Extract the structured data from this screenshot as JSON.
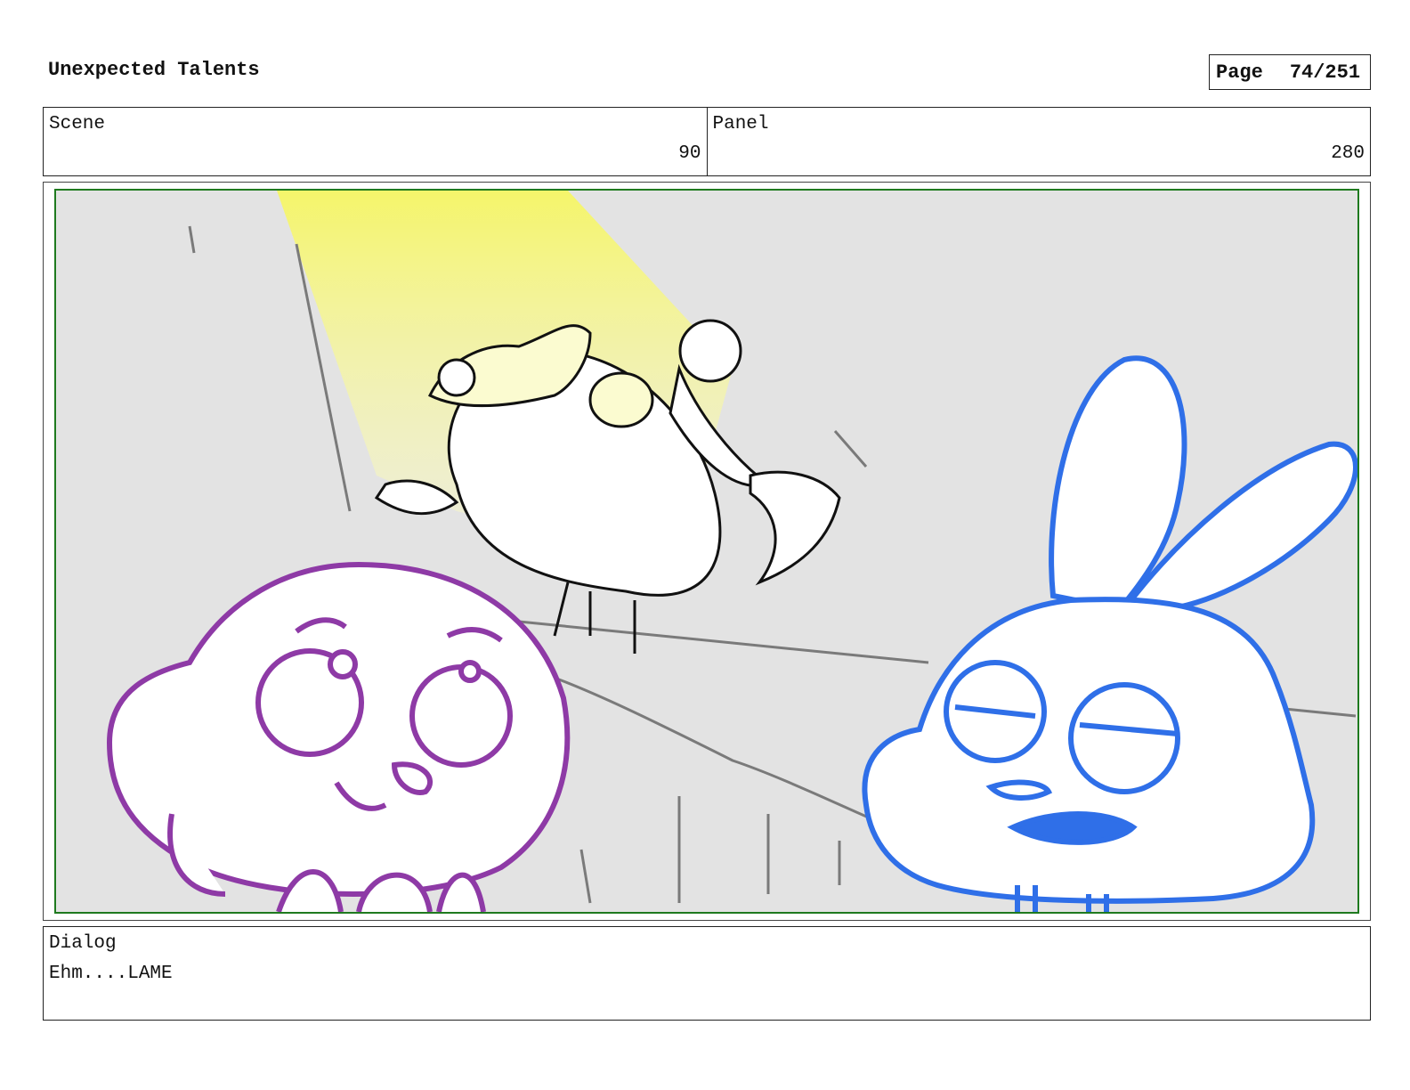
{
  "header": {
    "title": "Unexpected Talents",
    "page_label": "Page",
    "page_number": "74/251"
  },
  "scene": {
    "label": "Scene",
    "value": "90"
  },
  "panel": {
    "label": "Panel",
    "value": "280"
  },
  "artwork": {
    "colors": {
      "background": "#e3e3e3",
      "spotlight": "#f5f56a",
      "purple_character": "#8e3aa6",
      "blue_character": "#2f6fe8",
      "line": "#111111",
      "frame": "#1f7a1f"
    }
  },
  "dialog": {
    "label": "Dialog",
    "text": "Ehm....LAME"
  }
}
